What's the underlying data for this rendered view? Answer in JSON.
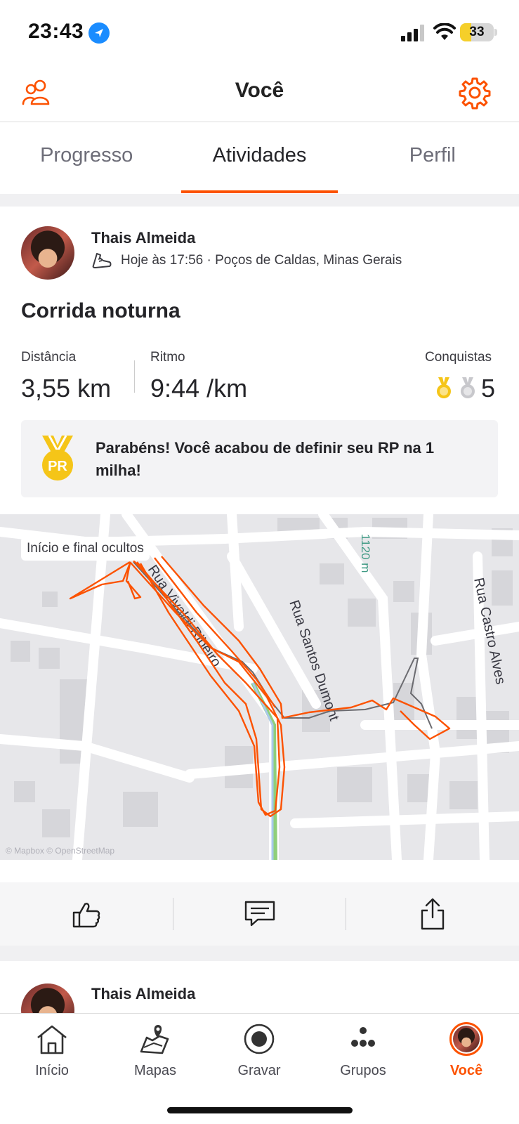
{
  "status_bar": {
    "time": "23:43",
    "battery": "33",
    "battery_level": 0.33
  },
  "header": {
    "title": "Você",
    "left_icon": "friends-icon",
    "right_icon": "gear-icon"
  },
  "tabs": [
    {
      "label": "Progresso",
      "active": false
    },
    {
      "label": "Atividades",
      "active": true
    },
    {
      "label": "Perfil",
      "active": false
    }
  ],
  "activity": {
    "athlete": "Thais Almeida",
    "datetime_location": "Hoje às 17:56 · Poços de Caldas, Minas Gerais",
    "title": "Corrida noturna",
    "stats": {
      "distance_label": "Distância",
      "distance_value": "3,55 km",
      "pace_label": "Ritmo",
      "pace_value": "9:44 /km",
      "achievements_label": "Conquistas",
      "achievements_count": "5"
    },
    "pr": {
      "badge": "PR",
      "message": "Parabéns! Você acabou de definir seu RP na 1 milha!"
    },
    "map": {
      "badge": "Início e final ocultos",
      "streets": [
        "Rua Vivaldi Ribeiro",
        "Rua Santos Dumont",
        "Rua Castro Alves",
        "1120 m"
      ],
      "attribution": "© Mapbox © OpenStreetMap",
      "route_color": "#fc5200"
    }
  },
  "actions": [
    {
      "name": "kudos",
      "icon": "thumbs-up-icon"
    },
    {
      "name": "comment",
      "icon": "comment-icon"
    },
    {
      "name": "share",
      "icon": "share-icon"
    }
  ],
  "next_activity": {
    "athlete": "Thais Almeida"
  },
  "bottom_nav": [
    {
      "label": "Início",
      "icon": "home-icon",
      "active": false
    },
    {
      "label": "Mapas",
      "icon": "map-icon",
      "active": false
    },
    {
      "label": "Gravar",
      "icon": "record-icon",
      "active": false
    },
    {
      "label": "Grupos",
      "icon": "groups-icon",
      "active": false
    },
    {
      "label": "Você",
      "icon": "avatar",
      "active": true
    }
  ],
  "colors": {
    "accent": "#fc5200",
    "gold": "#f5c518",
    "silver": "#c8c8cc"
  }
}
